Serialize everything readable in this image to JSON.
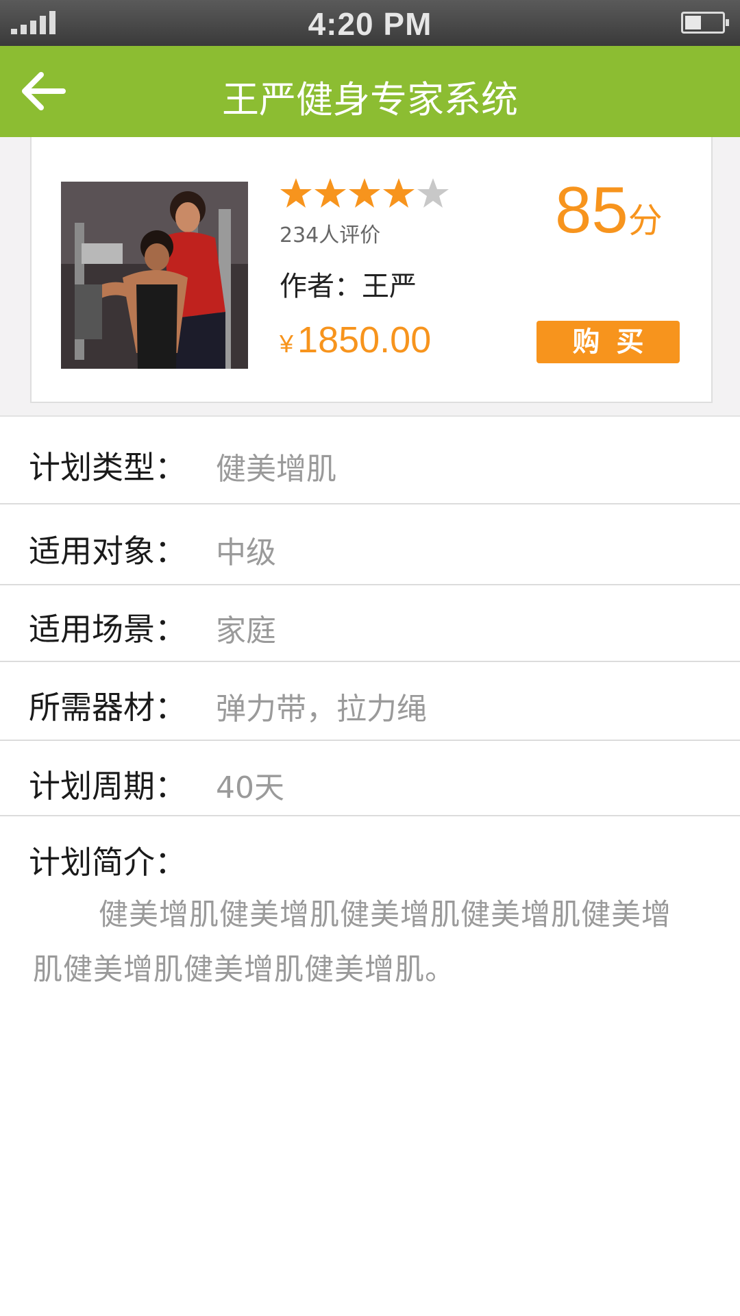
{
  "status_bar": {
    "time": "4:20 PM",
    "battery_level": 0.45
  },
  "nav": {
    "title": "王严健身专家系统",
    "back_icon": "arrow-left-icon"
  },
  "product": {
    "rating_stars": 4,
    "rating_max": 5,
    "review_count": "234人评价",
    "author": "作者：王严",
    "currency": "¥",
    "price": "1850.00",
    "score": "85",
    "score_unit": "分",
    "buy_label": "购买"
  },
  "colors": {
    "nav_green": "#8cbd32",
    "accent_orange": "#f7941d",
    "star_empty": "#c8c8c8"
  },
  "details": [
    {
      "label": "计划类型：",
      "value": "健美增肌"
    },
    {
      "label": "适用对象：",
      "value": "中级"
    },
    {
      "label": "适用场景：",
      "value": "家庭"
    },
    {
      "label": "所需器材：",
      "value": "弹力带，拉力绳"
    },
    {
      "label": "计划周期：",
      "value": "40天"
    }
  ],
  "description": {
    "label": "计划简介：",
    "text": "健美增肌健美增肌健美增肌健美增肌健美增肌健美增肌健美增肌健美增肌。"
  }
}
